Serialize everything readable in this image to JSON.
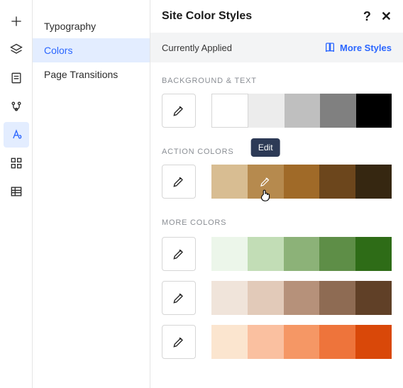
{
  "rail": {
    "items": [
      "add-icon",
      "layers-icon",
      "page-icon",
      "app-market-icon",
      "text-style-icon",
      "grid-icon",
      "table-icon"
    ],
    "activeIndex": 4
  },
  "subnav": {
    "items": [
      {
        "label": "Typography"
      },
      {
        "label": "Colors"
      },
      {
        "label": "Page Transitions"
      }
    ],
    "activeIndex": 1
  },
  "panel": {
    "title": "Site Color Styles",
    "appliedLabel": "Currently Applied",
    "moreStylesLabel": "More Styles",
    "tooltip": "Edit"
  },
  "sections": {
    "background": {
      "label": "BACKGROUND & TEXT",
      "colors": [
        "#FFFFFF",
        "#ECECEC",
        "#BFBFBF",
        "#808080",
        "#000000"
      ]
    },
    "action": {
      "label": "ACTION COLORS",
      "colors": [
        "#D8BD92",
        "#B68A4E",
        "#A06A28",
        "#6C461C",
        "#362711"
      ]
    },
    "more": {
      "label": "MORE COLORS",
      "rows": [
        [
          "#ECF6EA",
          "#C2DDB6",
          "#8CB278",
          "#5E8E47",
          "#2E6C17"
        ],
        [
          "#F0E4DA",
          "#E2CAB9",
          "#B6917A",
          "#8E6B53",
          "#604027"
        ],
        [
          "#FBE5CF",
          "#FAC0A0",
          "#F59765",
          "#EE743B",
          "#D94809"
        ]
      ]
    }
  }
}
